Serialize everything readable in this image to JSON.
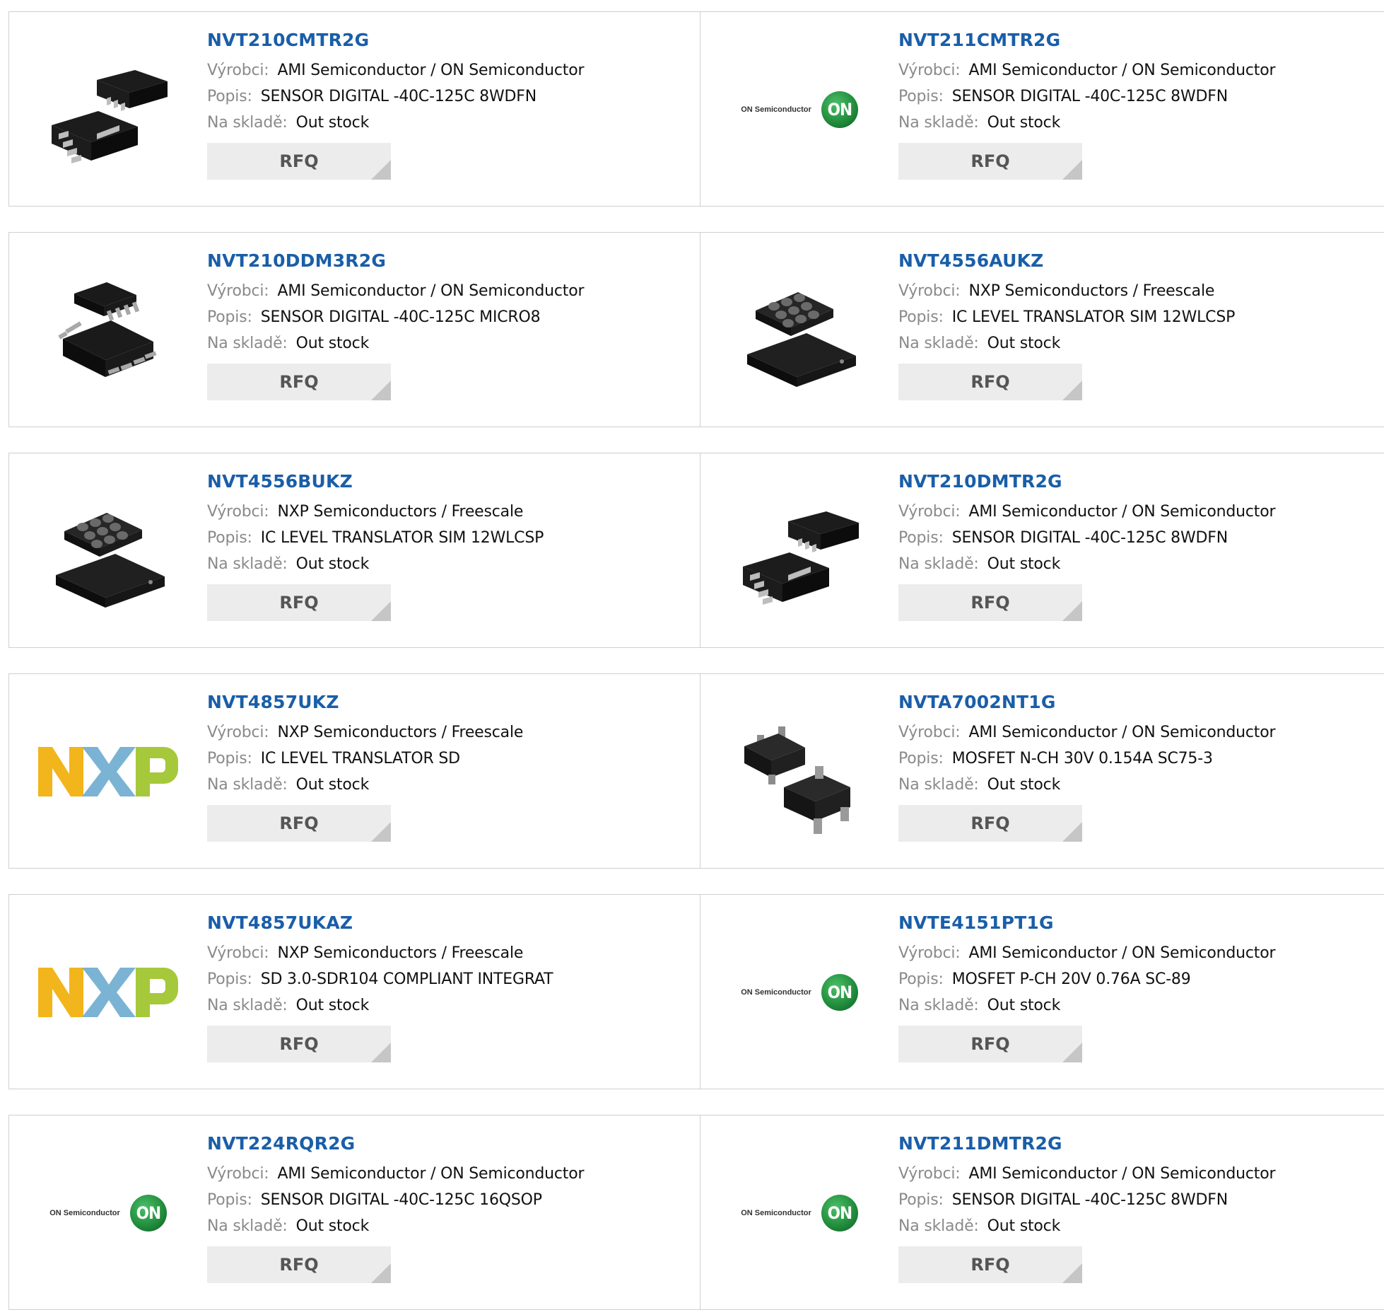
{
  "labels": {
    "manufacturer": "Výrobci:",
    "description": "Popis:",
    "stock": "Na skladě:",
    "rfq": "RFQ"
  },
  "logos": {
    "on_text": "ON Semiconductor",
    "on_badge": "ON"
  },
  "colors": {
    "link": "#1a5ea8",
    "rfq_bg": "#ececec",
    "on_green": "#1f8a3a",
    "nxp_yellow": "#f2b51b",
    "nxp_blue": "#7ab3d4",
    "nxp_green": "#a6c83b"
  },
  "products": [
    {
      "name": "NVT210CMTR2G",
      "manufacturer": "AMI Semiconductor / ON Semiconductor",
      "description": "SENSOR DIGITAL -40C-125C 8WDFN",
      "stock": "Out stock",
      "image": "chip-dfn-icon"
    },
    {
      "name": "NVT211CMTR2G",
      "manufacturer": "AMI Semiconductor / ON Semiconductor",
      "description": "SENSOR DIGITAL -40C-125C 8WDFN",
      "stock": "Out stock",
      "image": "on-semiconductor-logo"
    },
    {
      "name": "NVT210DDM3R2G",
      "manufacturer": "AMI Semiconductor / ON Semiconductor",
      "description": "SENSOR DIGITAL -40C-125C MICRO8",
      "stock": "Out stock",
      "image": "chip-msop-icon"
    },
    {
      "name": "NVT4556AUKZ",
      "manufacturer": "NXP Semiconductors / Freescale",
      "description": "IC LEVEL TRANSLATOR SIM 12WLCSP",
      "stock": "Out stock",
      "image": "chip-wlcsp-icon"
    },
    {
      "name": "NVT4556BUKZ",
      "manufacturer": "NXP Semiconductors / Freescale",
      "description": "IC LEVEL TRANSLATOR SIM 12WLCSP",
      "stock": "Out stock",
      "image": "chip-wlcsp-icon"
    },
    {
      "name": "NVT210DMTR2G",
      "manufacturer": "AMI Semiconductor / ON Semiconductor",
      "description": "SENSOR DIGITAL -40C-125C 8WDFN",
      "stock": "Out stock",
      "image": "chip-dfn-icon"
    },
    {
      "name": "NVT4857UKZ",
      "manufacturer": "NXP Semiconductors / Freescale",
      "description": "IC LEVEL TRANSLATOR SD",
      "stock": "Out stock",
      "image": "nxp-logo"
    },
    {
      "name": "NVTA7002NT1G",
      "manufacturer": "AMI Semiconductor / ON Semiconductor",
      "description": "MOSFET N-CH 30V 0.154A SC75-3",
      "stock": "Out stock",
      "image": "chip-sot-icon"
    },
    {
      "name": "NVT4857UKAZ",
      "manufacturer": "NXP Semiconductors / Freescale",
      "description": "SD 3.0-SDR104 COMPLIANT INTEGRAT",
      "stock": "Out stock",
      "image": "nxp-logo"
    },
    {
      "name": "NVTE4151PT1G",
      "manufacturer": "AMI Semiconductor / ON Semiconductor",
      "description": "MOSFET P-CH 20V 0.76A SC-89",
      "stock": "Out stock",
      "image": "on-semiconductor-logo"
    },
    {
      "name": "NVT224RQR2G",
      "manufacturer": "AMI Semiconductor / ON Semiconductor",
      "description": "SENSOR DIGITAL -40C-125C 16QSOP",
      "stock": "Out stock",
      "image": "on-semiconductor-logo"
    },
    {
      "name": "NVT211DMTR2G",
      "manufacturer": "AMI Semiconductor / ON Semiconductor",
      "description": "SENSOR DIGITAL -40C-125C 8WDFN",
      "stock": "Out stock",
      "image": "on-semiconductor-logo"
    }
  ]
}
